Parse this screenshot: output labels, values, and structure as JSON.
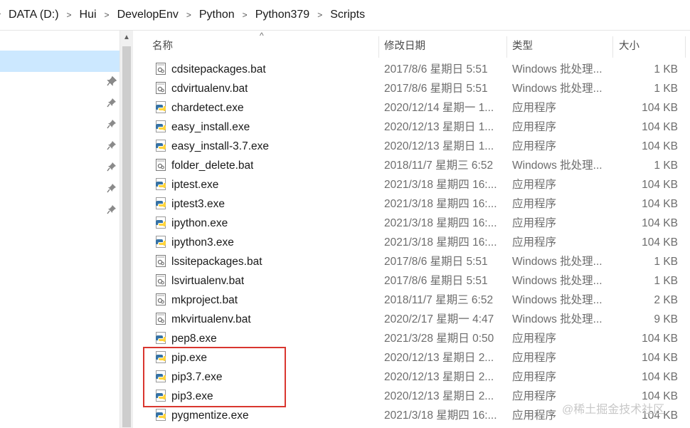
{
  "breadcrumb": [
    "DATA (D:)",
    "Hui",
    "DevelopEnv",
    "Python",
    "Python379",
    "Scripts"
  ],
  "columns": {
    "name": "名称",
    "date": "修改日期",
    "type": "类型",
    "size": "大小"
  },
  "files": [
    {
      "name": "cdsitepackages.bat",
      "date": "2017/8/6 星期日 5:51",
      "type": "Windows 批处理...",
      "size": "1 KB",
      "icon": "bat"
    },
    {
      "name": "cdvirtualenv.bat",
      "date": "2017/8/6 星期日 5:51",
      "type": "Windows 批处理...",
      "size": "1 KB",
      "icon": "bat"
    },
    {
      "name": "chardetect.exe",
      "date": "2020/12/14 星期一 1...",
      "type": "应用程序",
      "size": "104 KB",
      "icon": "py"
    },
    {
      "name": "easy_install.exe",
      "date": "2020/12/13 星期日 1...",
      "type": "应用程序",
      "size": "104 KB",
      "icon": "py"
    },
    {
      "name": "easy_install-3.7.exe",
      "date": "2020/12/13 星期日 1...",
      "type": "应用程序",
      "size": "104 KB",
      "icon": "py"
    },
    {
      "name": "folder_delete.bat",
      "date": "2018/11/7 星期三 6:52",
      "type": "Windows 批处理...",
      "size": "1 KB",
      "icon": "bat"
    },
    {
      "name": "iptest.exe",
      "date": "2021/3/18 星期四 16:...",
      "type": "应用程序",
      "size": "104 KB",
      "icon": "py"
    },
    {
      "name": "iptest3.exe",
      "date": "2021/3/18 星期四 16:...",
      "type": "应用程序",
      "size": "104 KB",
      "icon": "py"
    },
    {
      "name": "ipython.exe",
      "date": "2021/3/18 星期四 16:...",
      "type": "应用程序",
      "size": "104 KB",
      "icon": "py"
    },
    {
      "name": "ipython3.exe",
      "date": "2021/3/18 星期四 16:...",
      "type": "应用程序",
      "size": "104 KB",
      "icon": "py"
    },
    {
      "name": "lssitepackages.bat",
      "date": "2017/8/6 星期日 5:51",
      "type": "Windows 批处理...",
      "size": "1 KB",
      "icon": "bat"
    },
    {
      "name": "lsvirtualenv.bat",
      "date": "2017/8/6 星期日 5:51",
      "type": "Windows 批处理...",
      "size": "1 KB",
      "icon": "bat"
    },
    {
      "name": "mkproject.bat",
      "date": "2018/11/7 星期三 6:52",
      "type": "Windows 批处理...",
      "size": "2 KB",
      "icon": "bat"
    },
    {
      "name": "mkvirtualenv.bat",
      "date": "2020/2/17 星期一 4:47",
      "type": "Windows 批处理...",
      "size": "9 KB",
      "icon": "bat"
    },
    {
      "name": "pep8.exe",
      "date": "2021/3/28 星期日 0:50",
      "type": "应用程序",
      "size": "104 KB",
      "icon": "py"
    },
    {
      "name": "pip.exe",
      "date": "2020/12/13 星期日 2...",
      "type": "应用程序",
      "size": "104 KB",
      "icon": "py"
    },
    {
      "name": "pip3.7.exe",
      "date": "2020/12/13 星期日 2...",
      "type": "应用程序",
      "size": "104 KB",
      "icon": "py"
    },
    {
      "name": "pip3.exe",
      "date": "2020/12/13 星期日 2...",
      "type": "应用程序",
      "size": "104 KB",
      "icon": "py"
    },
    {
      "name": "pygmentize.exe",
      "date": "2021/3/18 星期四 16:...",
      "type": "应用程序",
      "size": "104 KB",
      "icon": "py"
    }
  ],
  "watermark": "@稀土掘金技术社区",
  "colors": {
    "selection": "#cce8ff",
    "highlight": "#d9362f",
    "python_blue": "#3572a5",
    "python_yellow": "#ffd43b"
  }
}
